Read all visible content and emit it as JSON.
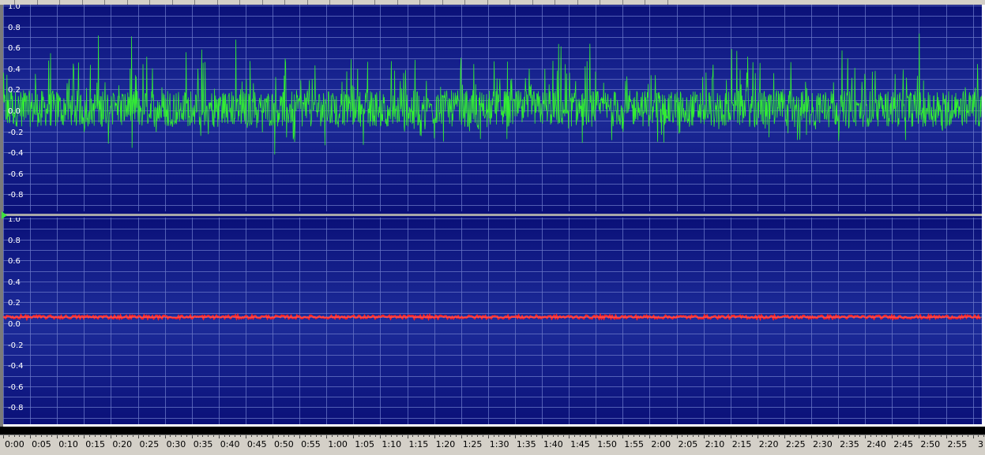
{
  "chart_data": {
    "type": "line",
    "tracks": [
      {
        "color": "#33ee33",
        "ylim": [
          -1.0,
          1.0
        ],
        "yticks": [
          "1.0",
          "0.8",
          "0.6",
          "0.4",
          "0.2",
          "0.0",
          "-0.2",
          "-0.4",
          "-0.6",
          "-0.8"
        ],
        "signal": "noise around 0.0, mostly between -0.3 and 0.4, peaks up to about 0.7 and down to about -0.7"
      },
      {
        "color": "#ff2222",
        "ylim": [
          -1.0,
          1.0
        ],
        "yticks": [
          "1.0",
          "0.8",
          "0.6",
          "0.4",
          "0.2",
          "0.0",
          "-0.2",
          "-0.4",
          "-0.6",
          "-0.8"
        ],
        "signal": "near-constant line at about 0.06"
      }
    ],
    "time_axis": [
      "0:00",
      "0:05",
      "0:10",
      "0:15",
      "0:20",
      "0:25",
      "0:30",
      "0:35",
      "0:40",
      "0:45",
      "0:50",
      "0:55",
      "1:00",
      "1:05",
      "1:10",
      "1:15",
      "1:20",
      "1:25",
      "1:30",
      "1:35",
      "1:40",
      "1:45",
      "1:50",
      "1:55",
      "2:00",
      "2:05",
      "2:10",
      "2:15",
      "2:20",
      "2:25",
      "2:30",
      "2:35",
      "2:40",
      "2:45",
      "2:50",
      "2:55",
      "3"
    ],
    "grid": true,
    "background": "#0a1078"
  },
  "markers": {
    "playhead_icon": "play-triangle-icon"
  }
}
